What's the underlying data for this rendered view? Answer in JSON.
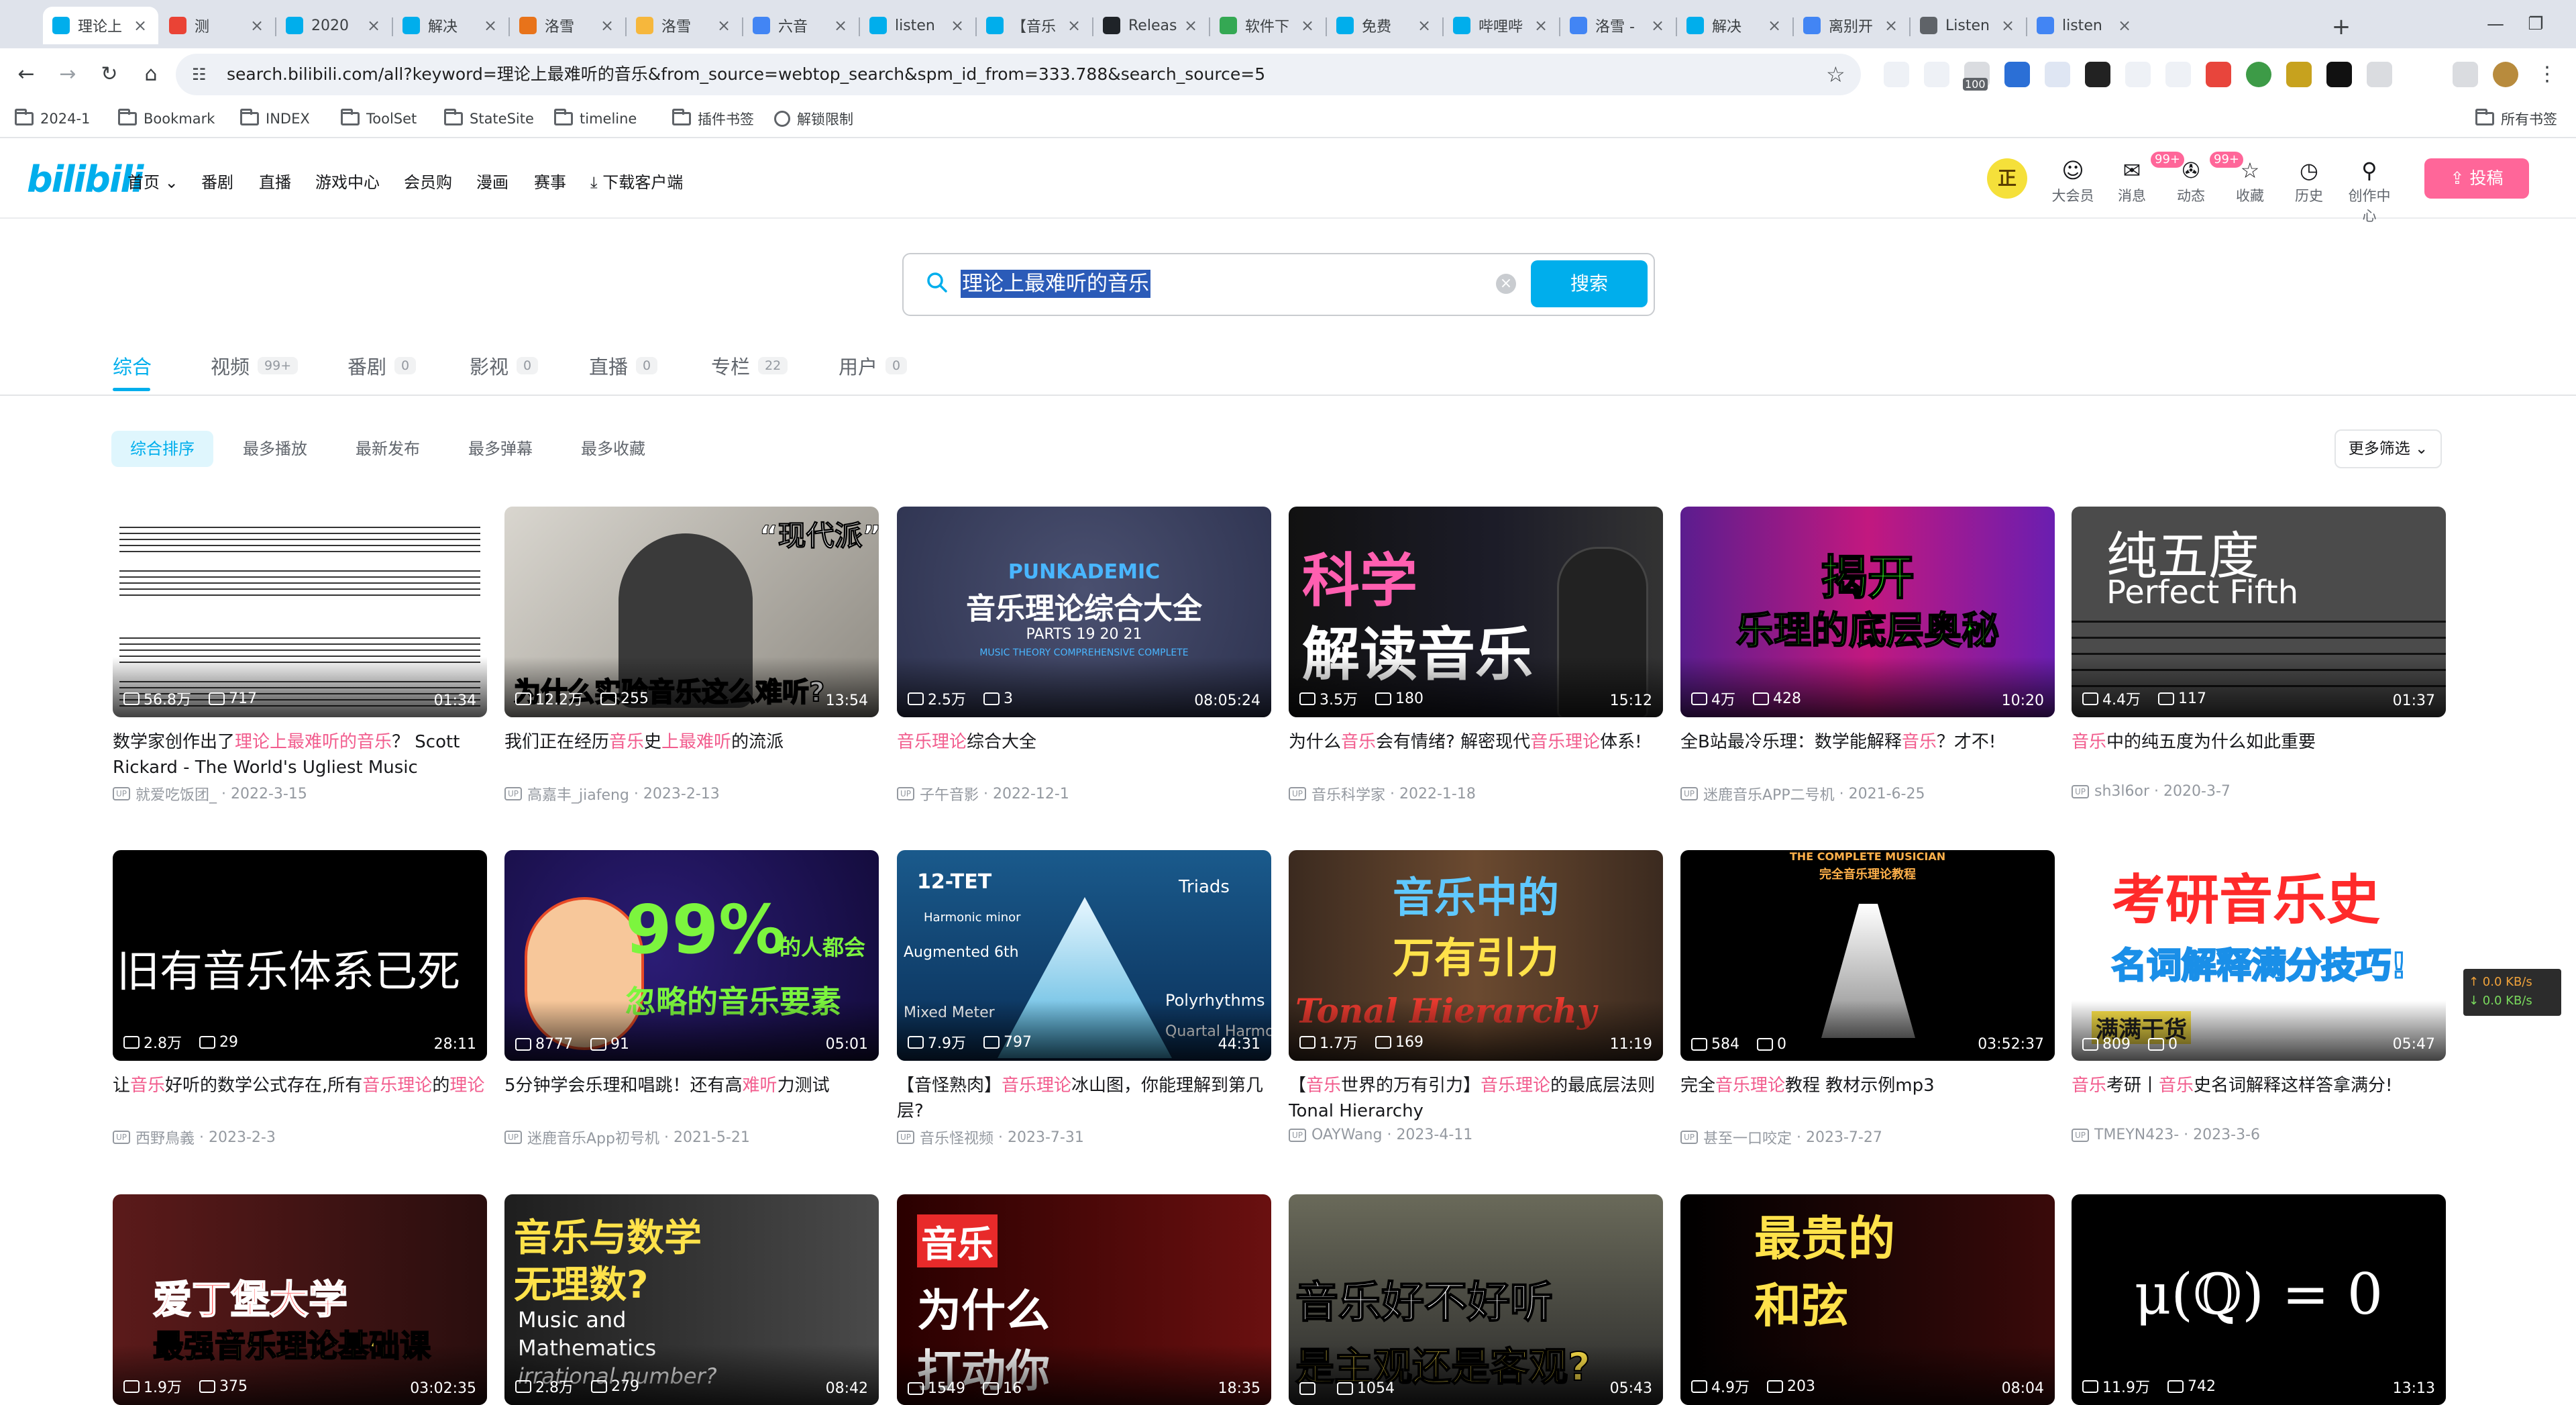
{
  "browser": {
    "tabs": [
      {
        "title": "理论上",
        "fav": "bilibili-favicon",
        "color": "#00aeec",
        "active": true
      },
      {
        "title": "测",
        "fav": "google-favicon",
        "color": "#ea4335"
      },
      {
        "title": "2020",
        "fav": "bilibili-favicon",
        "color": "#00aeec"
      },
      {
        "title": "解决",
        "fav": "bilibili-favicon",
        "color": "#00aeec"
      },
      {
        "title": "洛雪",
        "fav": "flag-favicon",
        "color": "#e8731a"
      },
      {
        "title": "洛雪",
        "fav": "emoji-favicon",
        "color": "#f6b73c"
      },
      {
        "title": "六音",
        "fav": "google-favicon",
        "color": "#4285f4"
      },
      {
        "title": "listen",
        "fav": "bilibili-favicon",
        "color": "#00aeec"
      },
      {
        "title": "【音乐",
        "fav": "bilibili-favicon",
        "color": "#00aeec"
      },
      {
        "title": "Releas",
        "fav": "github-favicon",
        "color": "#1f2328"
      },
      {
        "title": "软件下",
        "fav": "leaf-favicon",
        "color": "#34a853"
      },
      {
        "title": "免费",
        "fav": "bilibili-favicon",
        "color": "#00aeec"
      },
      {
        "title": "哔哩哔",
        "fav": "bilibili-favicon",
        "color": "#00aeec"
      },
      {
        "title": "洛雪 -",
        "fav": "google-favicon",
        "color": "#4285f4"
      },
      {
        "title": "解决",
        "fav": "bilibili-favicon",
        "color": "#00aeec"
      },
      {
        "title": "离别开",
        "fav": "google-favicon",
        "color": "#4285f4"
      },
      {
        "title": "Listen",
        "fav": "globe-favicon",
        "color": "#5f6368"
      },
      {
        "title": "listen",
        "fav": "google-favicon",
        "color": "#4285f4"
      }
    ],
    "new_tab": "+",
    "url": "search.bilibili.com/all?keyword=理论上最难听的音乐&from_source=webtop_search&spm_id_from=333.788&search_source=5",
    "ext_badge": "100",
    "bookmarks": [
      {
        "label": "2024-1"
      },
      {
        "label": "Bookmark"
      },
      {
        "label": "INDEX"
      },
      {
        "label": "ToolSet"
      },
      {
        "label": "StateSite"
      },
      {
        "label": "timeline"
      },
      {
        "label": "插件书签"
      },
      {
        "label": "解锁限制"
      }
    ],
    "all_bookmarks": "所有书签"
  },
  "header": {
    "logo": "bilibili",
    "nav": [
      "首页",
      "番剧",
      "直播",
      "游戏中心",
      "会员购",
      "漫画",
      "赛事",
      "下载客户端"
    ],
    "avatar_text": "正",
    "icons": [
      {
        "label": "大会员",
        "badge": ""
      },
      {
        "label": "消息",
        "badge": "99+"
      },
      {
        "label": "动态",
        "badge": "99+"
      },
      {
        "label": "收藏",
        "badge": ""
      },
      {
        "label": "历史",
        "badge": ""
      },
      {
        "label": "创作中心",
        "badge": ""
      }
    ],
    "upload": "投稿"
  },
  "search": {
    "query": "理论上最难听的音乐",
    "button": "搜索"
  },
  "type_tabs": [
    {
      "label": "综合",
      "count": ""
    },
    {
      "label": "视频",
      "count": "99+"
    },
    {
      "label": "番剧",
      "count": "0"
    },
    {
      "label": "影视",
      "count": "0"
    },
    {
      "label": "直播",
      "count": "0"
    },
    {
      "label": "专栏",
      "count": "22"
    },
    {
      "label": "用户",
      "count": "0"
    }
  ],
  "sort": [
    "综合排序",
    "最多播放",
    "最新发布",
    "最多弹幕",
    "最多收藏"
  ],
  "more_filter": "更多筛选",
  "videos": [
    {
      "plays": "56.8万",
      "danmaku": "717",
      "duration": "01:34",
      "title": [
        [
          "数学家创作出了",
          0
        ],
        [
          "理论上最难听的音乐",
          1
        ],
        [
          "？ Scott Rickard - The World's Ugliest Music",
          0
        ]
      ],
      "up": "就爱吃饭团_",
      "date": "2022-3-15"
    },
    {
      "plays": "12.2万",
      "danmaku": "255",
      "duration": "13:54",
      "title": [
        [
          "我们正在经历",
          0
        ],
        [
          "音乐",
          1
        ],
        [
          "史",
          0
        ],
        [
          "上最难听",
          1
        ],
        [
          "的流派",
          0
        ]
      ],
      "up": "高嘉丰_jiafeng",
      "date": "2023-2-13"
    },
    {
      "plays": "2.5万",
      "danmaku": "3",
      "duration": "08:05:24",
      "title": [
        [
          "音乐理论",
          1
        ],
        [
          "综合大全",
          0
        ]
      ],
      "up": "子午音影",
      "date": "2022-12-1"
    },
    {
      "plays": "3.5万",
      "danmaku": "180",
      "duration": "15:12",
      "title": [
        [
          "为什么",
          0
        ],
        [
          "音乐",
          1
        ],
        [
          "会有情绪? 解密现代",
          0
        ],
        [
          "音乐理论",
          1
        ],
        [
          "体系!",
          0
        ]
      ],
      "up": "音乐科学家",
      "date": "2022-1-18"
    },
    {
      "plays": "4万",
      "danmaku": "428",
      "duration": "10:20",
      "title": [
        [
          "全B站最冷乐理：数学能解释",
          0
        ],
        [
          "音乐",
          1
        ],
        [
          "？才不!",
          0
        ]
      ],
      "up": "迷鹿音乐APP二号机",
      "date": "2021-6-25"
    },
    {
      "plays": "4.4万",
      "danmaku": "117",
      "duration": "01:37",
      "title": [
        [
          "音乐",
          1
        ],
        [
          "中的纯五度为什么如此重要",
          0
        ]
      ],
      "up": "sh3l6or",
      "date": "2020-3-7"
    },
    {
      "plays": "2.8万",
      "danmaku": "29",
      "duration": "28:11",
      "title": [
        [
          "让",
          0
        ],
        [
          "音乐",
          1
        ],
        [
          "好听的数学公式存在,所有",
          0
        ],
        [
          "音乐理论",
          1
        ],
        [
          "的",
          0
        ],
        [
          "理论",
          1
        ]
      ],
      "up": "西野鳥義",
      "date": "2023-2-3"
    },
    {
      "plays": "8777",
      "danmaku": "91",
      "duration": "05:01",
      "title": [
        [
          "5分钟学会乐理和唱跳！还有高",
          0
        ],
        [
          "难听",
          1
        ],
        [
          "力测试",
          0
        ]
      ],
      "up": "迷鹿音乐App初号机",
      "date": "2021-5-21"
    },
    {
      "plays": "7.9万",
      "danmaku": "797",
      "duration": "44:31",
      "title": [
        [
          "【音怪熟肉】",
          0
        ],
        [
          "音乐理论",
          1
        ],
        [
          "冰山图，你能理解到第几层?",
          0
        ]
      ],
      "up": "音乐怪视频",
      "date": "2023-7-31"
    },
    {
      "plays": "1.7万",
      "danmaku": "169",
      "duration": "11:19",
      "title": [
        [
          "【",
          0
        ],
        [
          "音乐",
          1
        ],
        [
          "世界的万有引力】",
          0
        ],
        [
          "音乐理论",
          1
        ],
        [
          "的最",
          0
        ],
        [
          "底层法则Tonal Hierarchy",
          0
        ]
      ],
      "up": "OAYWang",
      "date": "2023-4-11"
    },
    {
      "plays": "584",
      "danmaku": "0",
      "duration": "03:52:37",
      "title": [
        [
          "完全",
          0
        ],
        [
          "音乐理论",
          1
        ],
        [
          "教程 教材示例mp3",
          0
        ]
      ],
      "up": "甚至一口咬定",
      "date": "2023-7-27"
    },
    {
      "plays": "809",
      "danmaku": "0",
      "duration": "05:47",
      "title": [
        [
          "音乐",
          1
        ],
        [
          "考研丨",
          0
        ],
        [
          "音乐",
          1
        ],
        [
          "史名词解释这样答拿满分!",
          0
        ]
      ],
      "up": "TMEYN423-",
      "date": "2023-3-6"
    },
    {
      "plays": "1.9万",
      "danmaku": "375",
      "duration": "03:02:35",
      "title": [],
      "up": "",
      "date": ""
    },
    {
      "plays": "2.8万",
      "danmaku": "279",
      "duration": "08:42",
      "title": [],
      "up": "",
      "date": ""
    },
    {
      "plays": "1549",
      "danmaku": "16",
      "duration": "18:35",
      "title": [],
      "up": "",
      "date": ""
    },
    {
      "plays": "",
      "danmaku": "1054",
      "duration": "05:43",
      "title": [],
      "up": "",
      "date": ""
    },
    {
      "plays": "4.9万",
      "danmaku": "203",
      "duration": "08:04",
      "title": [],
      "up": "",
      "date": ""
    },
    {
      "plays": "11.9万",
      "danmaku": "742",
      "duration": "13:13",
      "title": [],
      "up": "",
      "date": ""
    }
  ],
  "thumb_text": {
    "t1": "“现代派”",
    "t1b": "为什么实验音乐这么难听?",
    "t2a": "PUNKADEMIC",
    "t2b": "音乐理论综合大全",
    "t2c": "PARTS  19  20  21",
    "t2d": "MUSIC THEORY COMPREHENSIVE COMPLETE",
    "t3a": "科学",
    "t3b": "解读音乐",
    "t4a": "揭开",
    "t4b": "乐理的底层奥秘",
    "t5a": "纯五度",
    "t5b": "Perfect Fifth",
    "t6": "旧有音乐体系已死",
    "t7a": "99%",
    "t7b": "的人都会",
    "t7c": "忽略的音乐要素",
    "t8a": "12-TET",
    "t8b": "Triads",
    "t8c": "Harmonic minor",
    "t8d": "Augmented 6th",
    "t8e": "Polyrhythms",
    "t8f": "Mixed Meter",
    "t8g": "Quartal Harmony",
    "t9a": "音乐中的",
    "t9b": "万有引力",
    "t9c": "Tonal Hierarchy",
    "t10a": "THE COMPLETE MUSICIAN",
    "t10b": "完全音乐理论教程",
    "t11a": "考研音乐史",
    "t11b": "名词解释满分技巧!",
    "t11c": "满满干货",
    "t12a": "爱丁堡大学",
    "t12b": "最强音乐理论基础课",
    "t13a": "音乐与数学",
    "t13b": "无理数?",
    "t13c": "Music and",
    "t13d": "Mathematics",
    "t13e": "irrational number?",
    "t14a": "音乐",
    "t14b": "为什么",
    "t14c": "打动你",
    "t15a": "音乐好不好听",
    "t15b": "是主观还是客观?",
    "t16a": "最贵的",
    "t16b": "和弦",
    "t17": "μ(ℚ) = 0"
  },
  "net_speed": {
    "up": "↑ 0.0 KB/s",
    "down": "↓ 0.0 KB/s"
  },
  "colors": {
    "accent": "#00aeec",
    "highlight": "#f25d8e",
    "brand_pink": "#ff6699"
  }
}
